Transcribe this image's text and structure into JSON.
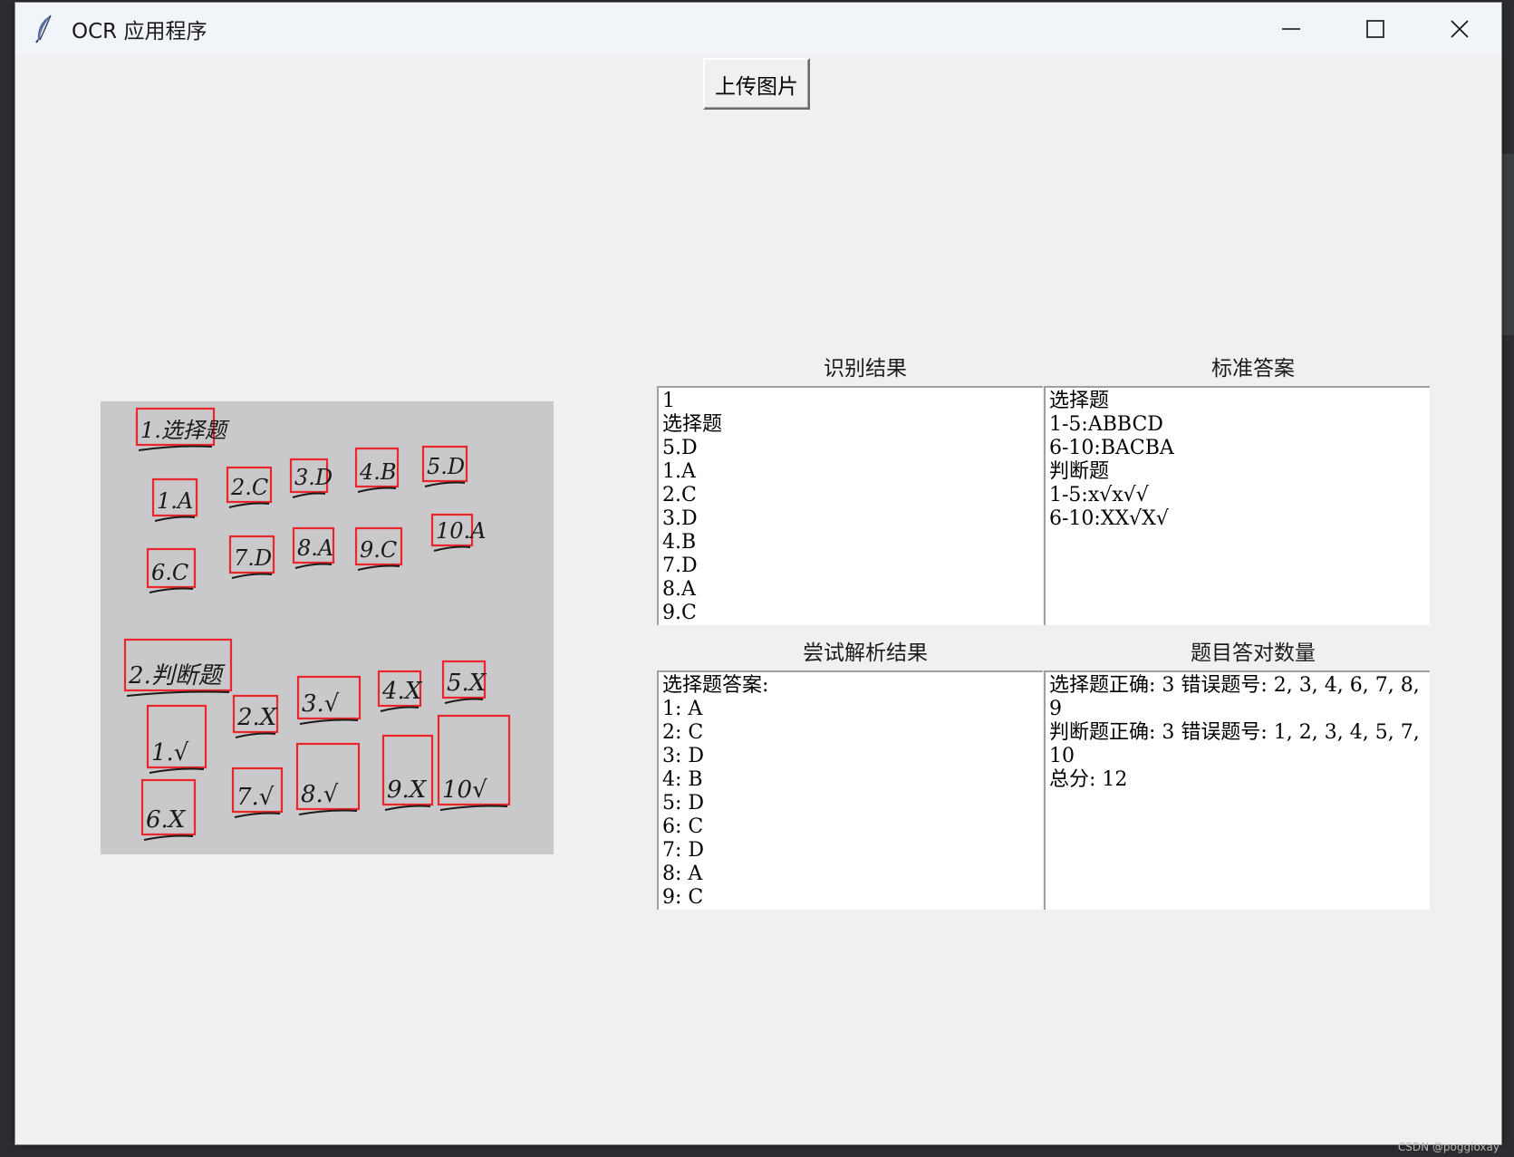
{
  "window": {
    "title": "OCR 应用程序",
    "app_icon": "feather-icon"
  },
  "toolbar": {
    "upload_label": "上传图片"
  },
  "panels": {
    "recognized": {
      "label": "识别结果",
      "lines": [
        "1",
        "选择题",
        "5.D",
        "1.A",
        "2.C",
        "3.D",
        "4.B",
        "7.D",
        "8.A",
        "9.C"
      ]
    },
    "standard": {
      "label": "标准答案",
      "lines": [
        "选择题",
        "1-5:ABBCD",
        "6-10:BACBA",
        "判断题",
        "1-5:x√x√√",
        "6-10:XX√X√"
      ]
    },
    "parsed": {
      "label": "尝试解析结果",
      "lines": [
        "选择题答案:",
        "1: A",
        "2: C",
        "3: D",
        "4: B",
        "5: D",
        "6: C",
        "7: D",
        "8: A",
        "9: C"
      ]
    },
    "score": {
      "label": "题目答对数量",
      "lines": [
        "选择题正确: 3 错误题号: 2, 3, 4, 6, 7, 8, 9",
        "判断题正确: 3 错误题号: 1, 2, 3, 4, 5, 7, 10",
        "总分: 12"
      ]
    }
  },
  "photo": {
    "section_headings": [
      "1.选择题",
      "2.判断题"
    ],
    "choice_answers": [
      "1.A",
      "2.C",
      "3.D",
      "4.B",
      "5.D",
      "6.C",
      "7.D",
      "8.A",
      "9.C",
      "10.A"
    ],
    "judge_answers": [
      "1.√",
      "2.X",
      "3.√",
      "4.X",
      "5.X",
      "6.X",
      "7.√",
      "8.√",
      "9.X",
      "10√"
    ]
  },
  "watermark": "CSDN @poggioxay",
  "colors": {
    "box": "#e8262c",
    "window_bg": "#f0f0f0",
    "paper": "#c7c7c9"
  }
}
